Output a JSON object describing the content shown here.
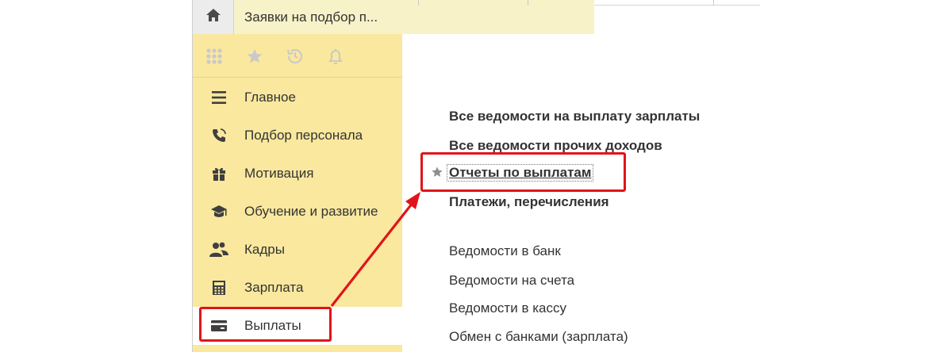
{
  "tabs": {
    "home_icon": "home-icon",
    "active_tab_label": "Заявки на подбор п..."
  },
  "toolbar": {
    "icons": [
      "apps-grid-icon",
      "star-icon",
      "history-icon",
      "bell-icon"
    ]
  },
  "sidebar": {
    "items": [
      {
        "label": "Главное",
        "icon": "menu-lines-icon"
      },
      {
        "label": "Подбор персонала",
        "icon": "phone-icon"
      },
      {
        "label": "Мотивация",
        "icon": "gift-icon"
      },
      {
        "label": "Обучение и развитие",
        "icon": "graduation-cap-icon"
      },
      {
        "label": "Кадры",
        "icon": "people-icon"
      },
      {
        "label": "Зарплата",
        "icon": "calculator-icon"
      },
      {
        "label": "Выплаты",
        "icon": "wallet-card-icon",
        "active": true
      }
    ]
  },
  "content": {
    "links": [
      {
        "label": "Все ведомости на выплату зарплаты",
        "bold": true
      },
      {
        "label": "Все ведомости прочих доходов",
        "bold": true
      },
      {
        "label": "Отчеты по выплатам",
        "bold": true,
        "favorite": true,
        "focused": true
      },
      {
        "label": "Платежи, перечисления",
        "bold": true
      },
      {
        "label": "Ведомости в банк",
        "bold": false
      },
      {
        "label": "Ведомости на счета",
        "bold": false
      },
      {
        "label": "Ведомости в кассу",
        "bold": false
      },
      {
        "label": "Обмен с банками (зарплата)",
        "bold": false
      }
    ]
  },
  "colors": {
    "sidebar_bg": "#f9e89e",
    "active_tab_bg": "#f7f2c8",
    "annotation_red": "#e1141b"
  }
}
